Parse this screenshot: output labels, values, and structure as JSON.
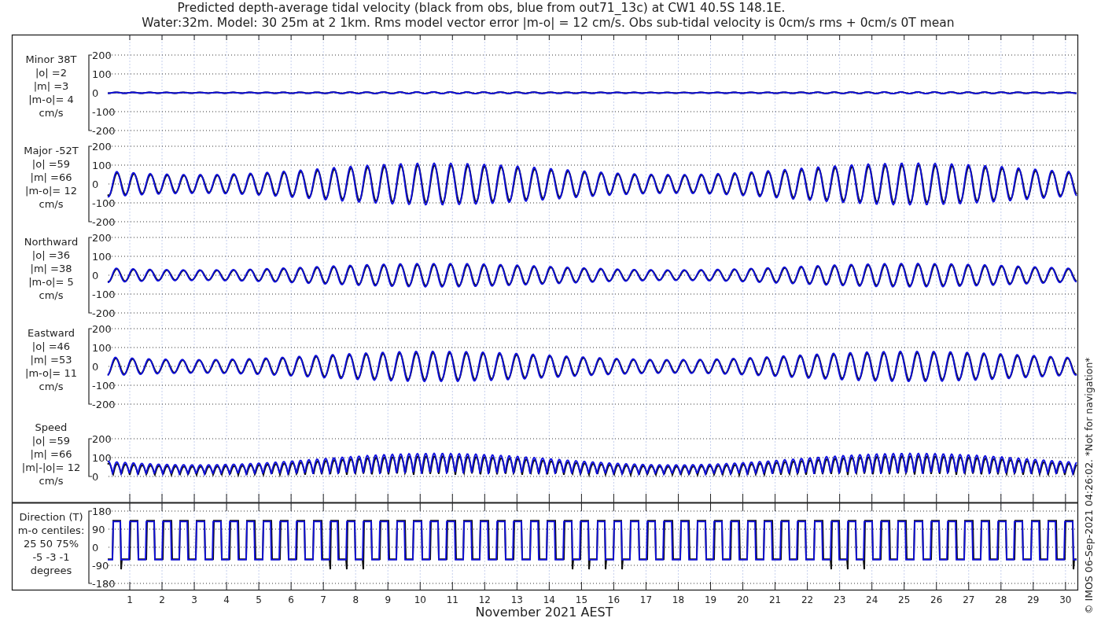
{
  "title_lines": [
    "Predicted depth-average tidal velocity (black from obs, blue from out71_13c) at CW1 40.5S 148.1E.",
    "Water:32m. Model: 30 25m at 2 1km. Rms model vector error |m-o| = 12 cm/s. Obs sub-tidal velocity is 0cm/s rms + 0cm/s 0T mean"
  ],
  "panels": [
    {
      "kind": "velocity",
      "label_lines": [
        "Minor 38T",
        "|o| =2",
        "|m| =3",
        "|m-o|= 4",
        "cm/s"
      ],
      "tick_labels": [
        "200",
        "100",
        "0",
        "-100",
        "-200"
      ]
    },
    {
      "kind": "velocity",
      "label_lines": [
        "Major -52T",
        "|o| =59",
        "|m| =66",
        "|m-o|= 12",
        "cm/s"
      ],
      "tick_labels": [
        "200",
        "100",
        "0",
        "-100",
        "-200"
      ]
    },
    {
      "kind": "velocity",
      "label_lines": [
        "Northward",
        "|o| =36",
        "|m| =38",
        "|m-o|= 5",
        "cm/s"
      ],
      "tick_labels": [
        "200",
        "100",
        "0",
        "-100",
        "-200"
      ]
    },
    {
      "kind": "velocity",
      "label_lines": [
        "Eastward",
        "|o| =46",
        "|m| =53",
        "|m-o|= 11",
        "cm/s"
      ],
      "tick_labels": [
        "200",
        "100",
        "0",
        "-100",
        "-200"
      ]
    },
    {
      "kind": "speed",
      "label_lines": [
        "Speed",
        "|o| =59",
        "|m| =66",
        "|m|-|o|= 12",
        "cm/s"
      ],
      "tick_labels": [
        "200",
        "100",
        "0"
      ]
    },
    {
      "kind": "direction",
      "label_lines": [
        "Direction (T)",
        "m-o centiles:",
        "25  50  75%",
        "-5 -3 -1",
        "degrees"
      ],
      "tick_labels": [
        "180",
        "90",
        "0",
        "-90",
        "-180"
      ]
    }
  ],
  "x_tick_labels": [
    "1",
    "2",
    "3",
    "4",
    "5",
    "6",
    "7",
    "8",
    "9",
    "10",
    "11",
    "12",
    "13",
    "14",
    "15",
    "16",
    "17",
    "18",
    "19",
    "20",
    "21",
    "22",
    "23",
    "24",
    "25",
    "26",
    "27",
    "28",
    "29",
    "30"
  ],
  "xlabel": "November 2021 AEST",
  "footer": "© IMOS 06-Sep-2021 04:26:02. *Not for navigation*"
}
